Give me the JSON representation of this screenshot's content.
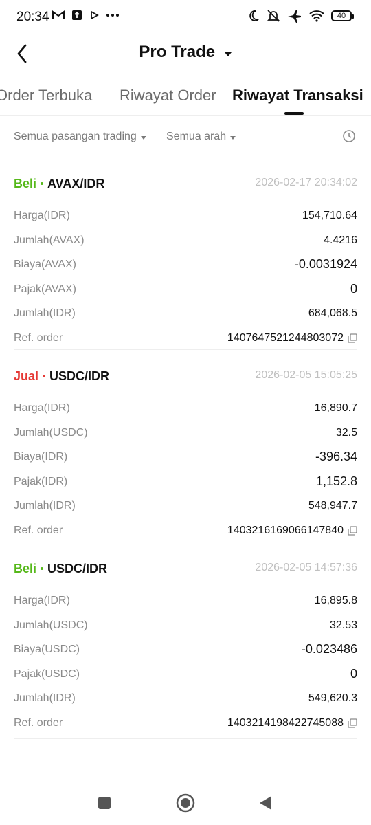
{
  "status_bar": {
    "time": "20:34",
    "left_icons": [
      "gmail-icon",
      "upload-icon",
      "play-icon",
      "more-dots-icon"
    ],
    "right_icons": [
      "moon-icon",
      "bell-off-icon",
      "airplane-icon",
      "wifi-icon"
    ],
    "battery": "40"
  },
  "header": {
    "title": "Pro Trade",
    "back_icon": "chevron-left-icon",
    "dropdown_icon": "caret-down-icon"
  },
  "tabs": [
    {
      "label": "Order Terbuka",
      "active": false
    },
    {
      "label": "Riwayat Order",
      "active": false
    },
    {
      "label": "Riwayat Transaksi",
      "active": true
    }
  ],
  "filters": {
    "pair": "Semua pasangan trading",
    "direction": "Semua arah",
    "history_icon": "clock-icon"
  },
  "colors": {
    "buy": "#56b81a",
    "sell": "#e53935",
    "muted": "#8a8a8a",
    "timestamp": "#c0c0c0"
  },
  "transactions": [
    {
      "side": "Beli",
      "pair": "AVAX/IDR",
      "time": "2026-02-17 20:34:02",
      "rows": [
        {
          "label": "Harga(IDR)",
          "value": "154,710.64"
        },
        {
          "label": "Jumlah(AVAX)",
          "value": "4.4216"
        },
        {
          "label": "Biaya(AVAX)",
          "value": "-0.0031924"
        },
        {
          "label": "Pajak(AVAX)",
          "value": "0"
        },
        {
          "label": "Jumlah(IDR)",
          "value": "684,068.5"
        },
        {
          "label": "Ref. order",
          "value": "1407647521244803072"
        }
      ]
    },
    {
      "side": "Jual",
      "pair": "USDC/IDR",
      "time": "2026-02-05 15:05:25",
      "rows": [
        {
          "label": "Harga(IDR)",
          "value": "16,890.7"
        },
        {
          "label": "Jumlah(USDC)",
          "value": "32.5"
        },
        {
          "label": "Biaya(IDR)",
          "value": "-396.34"
        },
        {
          "label": "Pajak(IDR)",
          "value": "1,152.8"
        },
        {
          "label": "Jumlah(IDR)",
          "value": "548,947.7"
        },
        {
          "label": "Ref. order",
          "value": "1403216169066147840"
        }
      ]
    },
    {
      "side": "Beli",
      "pair": "USDC/IDR",
      "time": "2026-02-05 14:57:36",
      "rows": [
        {
          "label": "Harga(IDR)",
          "value": "16,895.8"
        },
        {
          "label": "Jumlah(USDC)",
          "value": "32.53"
        },
        {
          "label": "Biaya(USDC)",
          "value": "-0.023486"
        },
        {
          "label": "Pajak(USDC)",
          "value": "0"
        },
        {
          "label": "Jumlah(IDR)",
          "value": "549,620.3"
        },
        {
          "label": "Ref. order",
          "value": "1403214198422745088"
        }
      ]
    }
  ],
  "navbar": {
    "icons": [
      "recents-square-icon",
      "home-circle-icon",
      "back-triangle-icon"
    ]
  }
}
